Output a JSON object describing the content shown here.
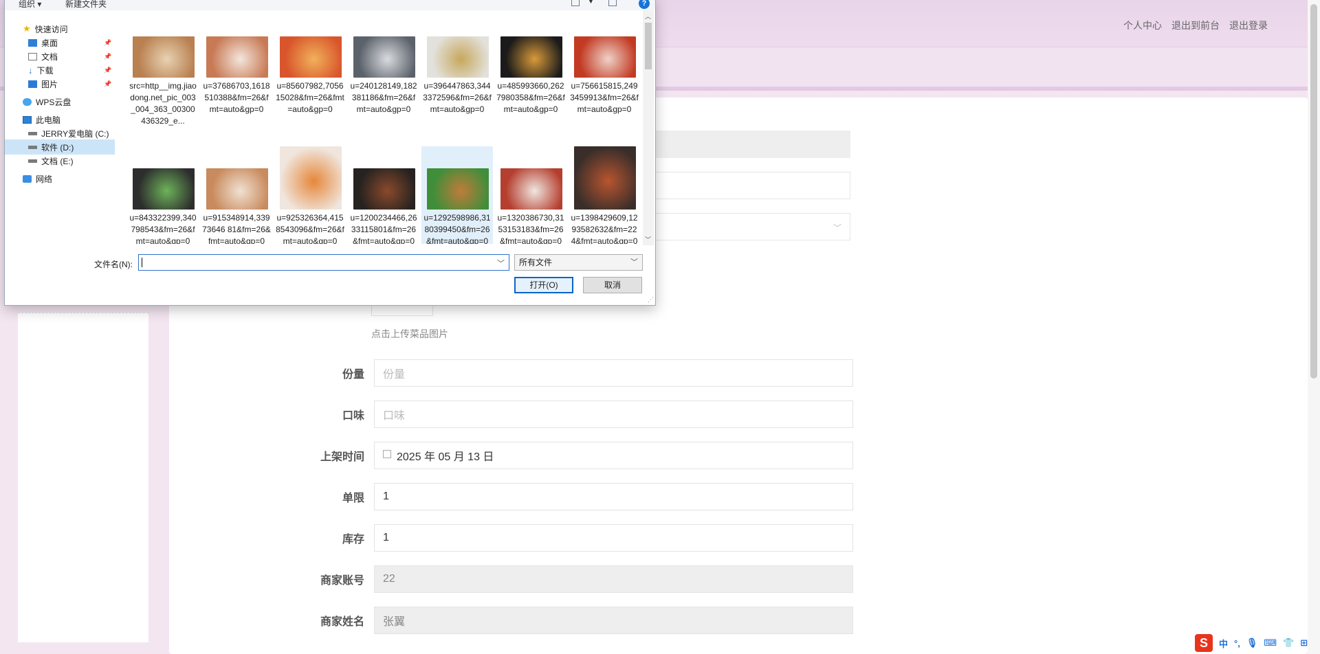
{
  "app": {
    "top_links": [
      "个人中心",
      "退出到前台",
      "退出登录"
    ],
    "upload_hint": "点击上传菜品图片",
    "form": [
      {
        "label": "份量",
        "value": "份量",
        "placeholder": true,
        "readonly": false
      },
      {
        "label": "口味",
        "value": "口味",
        "placeholder": true,
        "readonly": false
      },
      {
        "label": "上架时间",
        "value": "2025 年 05 月 13 日",
        "placeholder": false,
        "readonly": false,
        "calendar": true
      },
      {
        "label": "单限",
        "value": "1",
        "placeholder": false,
        "readonly": false
      },
      {
        "label": "库存",
        "value": "1",
        "placeholder": false,
        "readonly": false
      },
      {
        "label": "商家账号",
        "value": "22",
        "placeholder": false,
        "readonly": true
      },
      {
        "label": "商家姓名",
        "value": "张翼",
        "placeholder": false,
        "readonly": true
      }
    ]
  },
  "dialog": {
    "toolbar": {
      "organize": "组织 ▾",
      "new_folder": "新建文件夹",
      "help": "?"
    },
    "nav": [
      {
        "label": "快速访问",
        "icon": "star",
        "pinned": false,
        "indent": 0
      },
      {
        "label": "桌面",
        "icon": "desk",
        "pinned": true,
        "indent": 1
      },
      {
        "label": "文档",
        "icon": "doc",
        "pinned": true,
        "indent": 1
      },
      {
        "label": "下载",
        "icon": "down",
        "pinned": true,
        "indent": 1
      },
      {
        "label": "图片",
        "icon": "pic",
        "pinned": true,
        "indent": 1
      },
      {
        "label": "WPS云盘",
        "icon": "cloud",
        "pinned": false,
        "indent": 0
      },
      {
        "label": "此电脑",
        "icon": "pc",
        "pinned": false,
        "indent": 0
      },
      {
        "label": "JERRY爱电脑 (C:)",
        "icon": "drv",
        "pinned": false,
        "indent": 1
      },
      {
        "label": "软件 (D:)",
        "icon": "drv",
        "pinned": false,
        "indent": 1,
        "selected": true
      },
      {
        "label": "文档 (E:)",
        "icon": "drv",
        "pinned": false,
        "indent": 1
      },
      {
        "label": "网络",
        "icon": "net",
        "pinned": false,
        "indent": 0
      }
    ],
    "files": [
      {
        "name": "src=http__img.jiaodong.net_pic_003_004_363_00300436329_e...",
        "color1": "#b98050",
        "color2": "#e8d2b2"
      },
      {
        "name": "u=37686703,1618510388&fm=26&fmt=auto&gp=0",
        "color1": "#c87a55",
        "color2": "#f3e6dc"
      },
      {
        "name": "u=85607982,705615028&fm=26&fmt=auto&gp=0",
        "color1": "#d9562c",
        "color2": "#f0b15b"
      },
      {
        "name": "u=240128149,182381186&fm=26&fmt=auto&gp=0",
        "color1": "#5c626b",
        "color2": "#d9dbdf"
      },
      {
        "name": "u=396447863,3443372596&fm=26&fmt=auto&gp=0",
        "color1": "#e3e1dc",
        "color2": "#c7a85c"
      },
      {
        "name": "u=485993660,2627980358&fm=26&fmt=auto&gp=0",
        "color1": "#1b1b1b",
        "color2": "#d99a3a"
      },
      {
        "name": "u=756615815,2493459913&fm=26&fmt=auto&gp=0",
        "color1": "#c23a22",
        "color2": "#efd2c8"
      },
      {
        "name": "u=843322399,340798543&fm=26&fmt=auto&gp=0",
        "color1": "#2d2d2d",
        "color2": "#6db35a"
      },
      {
        "name": "u=915348914,33973646 81&fm=26&fmt=auto&gp=0",
        "color1": "#c98a5d",
        "color2": "#f0e1d2"
      },
      {
        "name": "u=925326364,4158543096&fm=26&fmt=auto&gp=0",
        "color1": "#f0e6de",
        "color2": "#e6873a"
      },
      {
        "name": "u=1200234466,2633115801&fm=26&fmt=auto&gp=0",
        "color1": "#262220",
        "color2": "#8a4a2c"
      },
      {
        "name": "u=1292598986,3180399450&fm=26&fmt=auto&gp=0",
        "color1": "#3f8e3a",
        "color2": "#c07b3a"
      },
      {
        "name": "u=1320386730,3153153183&fm=26&fmt=auto&gp=0",
        "color1": "#b53f2f",
        "color2": "#f0e6e1"
      },
      {
        "name": "u=1398429609,1293582632&fm=224&fmt=auto&gp=0",
        "color1": "#3a2e2a",
        "color2": "#b8552f"
      }
    ],
    "selected_file_index": 11,
    "filename_label": "文件名(N):",
    "filename_value": "",
    "filter_value": "所有文件",
    "open_label": "打开(O)",
    "cancel_label": "取消"
  },
  "tray": {
    "logo": "S",
    "ime": "中",
    "punct": "°,"
  }
}
